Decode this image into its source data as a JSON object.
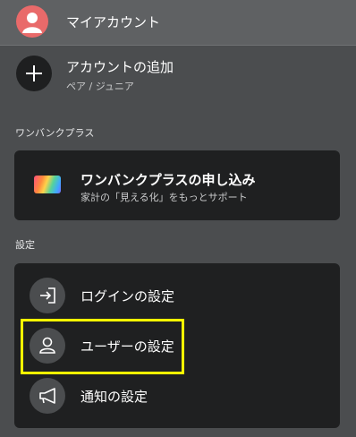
{
  "account": {
    "name": "マイアカウント"
  },
  "add_account": {
    "title": "アカウントの追加",
    "subtitle": "ペア / ジュニア"
  },
  "plus_section": {
    "label": "ワンバンクプラス",
    "card_title": "ワンバンクプラスの申し込み",
    "card_subtitle": "家計の「見える化」をもっとサポート"
  },
  "settings_section": {
    "label": "設定",
    "items": [
      {
        "label": "ログインの設定",
        "icon": "login-icon"
      },
      {
        "label": "ユーザーの設定",
        "icon": "user-icon"
      },
      {
        "label": "通知の設定",
        "icon": "megaphone-icon"
      }
    ]
  },
  "colors": {
    "highlight": "#ffff00",
    "avatar": "#e96a6a",
    "card": "#1f2021"
  }
}
